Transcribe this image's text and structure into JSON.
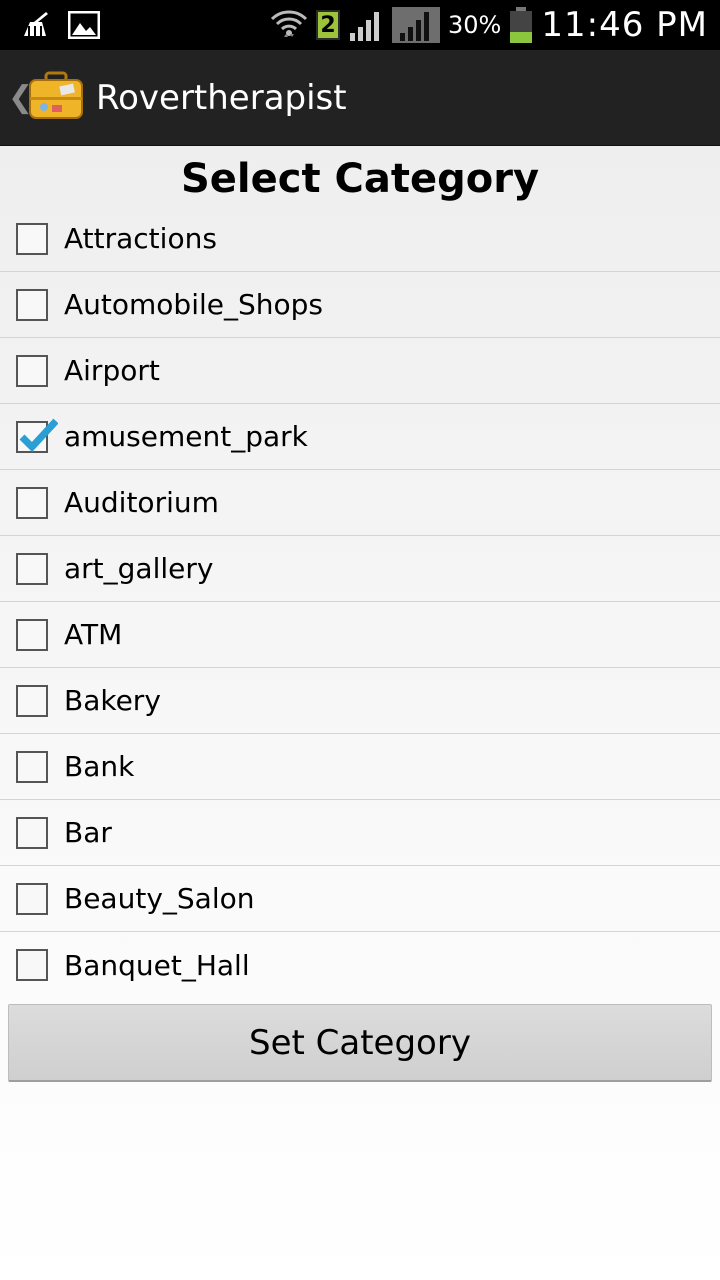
{
  "status_bar": {
    "left_icons": [
      "cleaner-icon",
      "image-icon"
    ],
    "right_icons": [
      "wifi-icon",
      "sim-badge-icon",
      "signal-icon",
      "signal-icon-2",
      "battery-icon"
    ],
    "sim_badge": "2",
    "battery_percent": "30%",
    "time": "11:46 PM"
  },
  "action_bar": {
    "up_caret": "❮",
    "logo_icon": "suitcase-icon",
    "title": "Rovertherapist"
  },
  "page": {
    "title": "Select Category"
  },
  "categories": [
    {
      "label": "Attractions",
      "checked": false
    },
    {
      "label": "Automobile_Shops",
      "checked": false
    },
    {
      "label": "Airport",
      "checked": false
    },
    {
      "label": "amusement_park",
      "checked": true
    },
    {
      "label": "Auditorium",
      "checked": false
    },
    {
      "label": "art_gallery",
      "checked": false
    },
    {
      "label": "ATM",
      "checked": false
    },
    {
      "label": "Bakery",
      "checked": false
    },
    {
      "label": "Bank",
      "checked": false
    },
    {
      "label": "Bar",
      "checked": false
    },
    {
      "label": "Beauty_Salon",
      "checked": false
    },
    {
      "label": "Banquet_Hall",
      "checked": false
    }
  ],
  "actions": {
    "set_category_label": "Set Category"
  },
  "colors": {
    "status_bar_bg": "#000000",
    "action_bar_bg": "#222222",
    "check_accent": "#2a9fd6",
    "battery_green": "#8cc63f"
  }
}
